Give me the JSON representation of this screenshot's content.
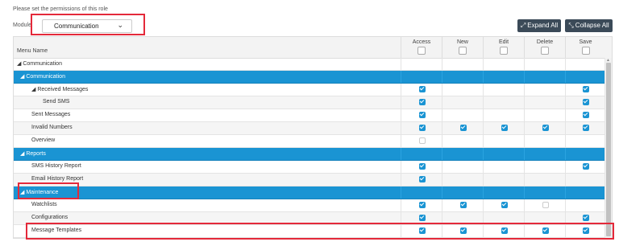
{
  "instructions": "Please set the permissions of this role",
  "module": {
    "label": "Module",
    "value": "Communication"
  },
  "buttons": {
    "expand": "Expand All",
    "collapse": "Collapse All"
  },
  "columns": {
    "name": "Menu Name",
    "access": "Access",
    "new": "New",
    "edit": "Edit",
    "delete": "Delete",
    "save": "Save"
  },
  "colors": {
    "group_row": "#1a94d3",
    "highlight": "#e4293a",
    "button": "#3b4a58"
  },
  "rows": [
    {
      "name": "◢ Communication",
      "level": 0,
      "type": "root",
      "perms": [
        null,
        null,
        null,
        null,
        null
      ]
    },
    {
      "name": "◢ Communication",
      "level": 1,
      "type": "group",
      "perms": [
        null,
        null,
        null,
        null,
        null
      ]
    },
    {
      "name": "◢ Received Messages",
      "level": 2,
      "type": "item",
      "perms": [
        true,
        null,
        null,
        null,
        true
      ]
    },
    {
      "name": "Send SMS",
      "level": 3,
      "type": "item",
      "perms": [
        true,
        null,
        null,
        null,
        true
      ]
    },
    {
      "name": "Sent Messages",
      "level": 2,
      "type": "item",
      "perms": [
        true,
        null,
        null,
        null,
        true
      ]
    },
    {
      "name": "Invalid Numbers",
      "level": 2,
      "type": "item",
      "perms": [
        true,
        true,
        true,
        true,
        true
      ]
    },
    {
      "name": "Overview",
      "level": 2,
      "type": "item",
      "perms": [
        false,
        null,
        null,
        null,
        null
      ]
    },
    {
      "name": "◢ Reports",
      "level": 1,
      "type": "group",
      "perms": [
        null,
        null,
        null,
        null,
        null
      ]
    },
    {
      "name": "SMS History Report",
      "level": 2,
      "type": "item",
      "perms": [
        true,
        null,
        null,
        null,
        true
      ]
    },
    {
      "name": "Email History Report",
      "level": 2,
      "type": "item",
      "perms": [
        true,
        null,
        null,
        null,
        null
      ]
    },
    {
      "name": "◢ Maintenance",
      "level": 1,
      "type": "group",
      "perms": [
        null,
        null,
        null,
        null,
        null
      ]
    },
    {
      "name": "Watchlists",
      "level": 2,
      "type": "item",
      "perms": [
        true,
        true,
        true,
        false,
        null
      ]
    },
    {
      "name": "Configurations",
      "level": 2,
      "type": "item",
      "perms": [
        true,
        null,
        null,
        null,
        true
      ]
    },
    {
      "name": "Message Templates",
      "level": 2,
      "type": "item",
      "perms": [
        true,
        true,
        true,
        true,
        true
      ]
    }
  ]
}
